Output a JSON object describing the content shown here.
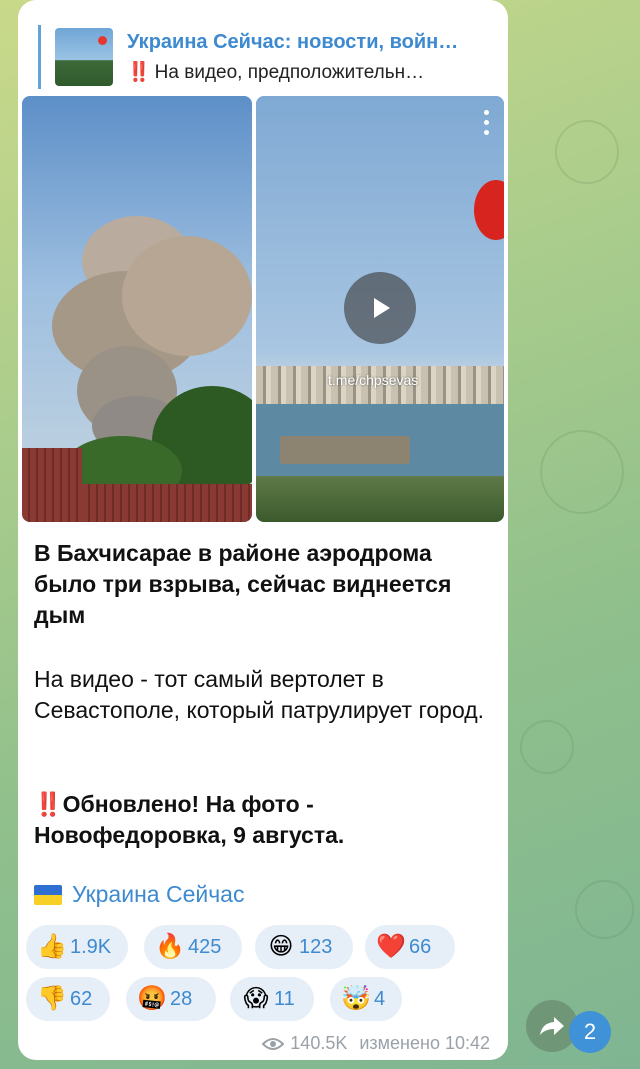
{
  "reply": {
    "title": "Украина Сейчас: новости, войн…",
    "marker": "‼️",
    "text": "На видео, предположительн…"
  },
  "video": {
    "watermark": "t.me/chpsevas"
  },
  "message": {
    "para1": "В Бахчисарае в районе аэродрома было три взрыва, сейчас виднеется дым",
    "para2": "На видео - тот самый вертолет в Севастополе, который патрулирует город.",
    "para3_marker": "‼️",
    "para3": "Обновлено! На фото - Новофедоровка, 9 августа.",
    "channel_link": "Украина Сейчас"
  },
  "reactions": [
    {
      "icon": "thumbs-up-icon",
      "emoji": "👍",
      "count": "1.9K"
    },
    {
      "icon": "fire-icon",
      "emoji": "🔥",
      "count": "425"
    },
    {
      "icon": "grinning-face-icon",
      "emoji": "😁",
      "count": "123"
    },
    {
      "icon": "heart-icon",
      "emoji": "❤️",
      "count": "66"
    },
    {
      "icon": "thumbs-down-icon",
      "emoji": "👎",
      "count": "62"
    },
    {
      "icon": "cursing-face-icon",
      "emoji": "🤬",
      "count": "28"
    },
    {
      "icon": "screaming-face-icon",
      "emoji": "😱",
      "count": "11"
    },
    {
      "icon": "exploding-head-icon",
      "emoji": "🤯",
      "count": "4"
    }
  ],
  "meta": {
    "views": "140.5K",
    "edited": "изменено 10:42"
  },
  "unread_count": "2",
  "colors": {
    "accent": "#3d8ad0",
    "reaction_bg": "#e6eef7",
    "badge": "#3f91d8",
    "exclaim": "#e2342b"
  }
}
